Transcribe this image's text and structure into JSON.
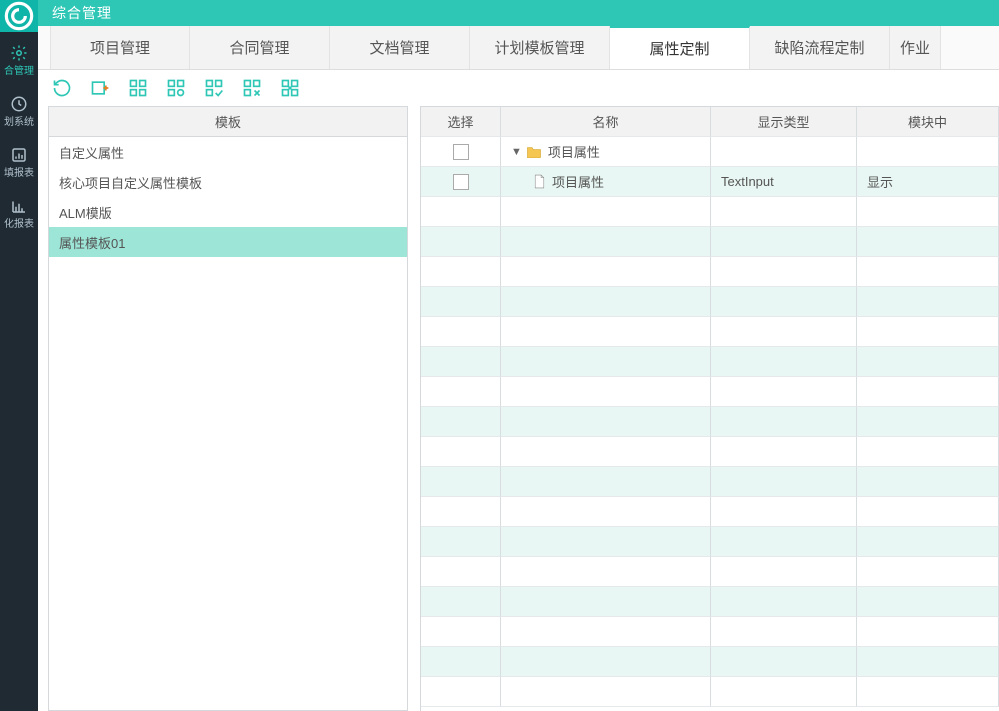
{
  "header": {
    "title": "综合管理"
  },
  "side_rail": {
    "items": [
      {
        "label": ""
      },
      {
        "label": "合管理"
      },
      {
        "label": "划系统"
      },
      {
        "label": "填报表"
      },
      {
        "label": "化报表"
      }
    ]
  },
  "tabs": [
    {
      "label": "项目管理"
    },
    {
      "label": "合同管理"
    },
    {
      "label": "文档管理"
    },
    {
      "label": "计划模板管理"
    },
    {
      "label": "属性定制"
    },
    {
      "label": "缺陷流程定制"
    },
    {
      "label": "作业"
    }
  ],
  "active_tab_index": 4,
  "template_panel": {
    "header": "模板",
    "items": [
      {
        "label": "自定义属性"
      },
      {
        "label": "核心项目自定义属性模板"
      },
      {
        "label": "ALM模版"
      },
      {
        "label": "属性模板01"
      }
    ],
    "active_index": 3
  },
  "attr_table": {
    "headers": {
      "select": "选择",
      "name": "名称",
      "display_type": "显示类型",
      "module": "模块中"
    },
    "rows": [
      {
        "kind": "folder",
        "name": "项目属性",
        "display_type": "",
        "module": ""
      },
      {
        "kind": "leaf",
        "name": "项目属性",
        "display_type": "TextInput",
        "module": "显示"
      }
    ]
  }
}
